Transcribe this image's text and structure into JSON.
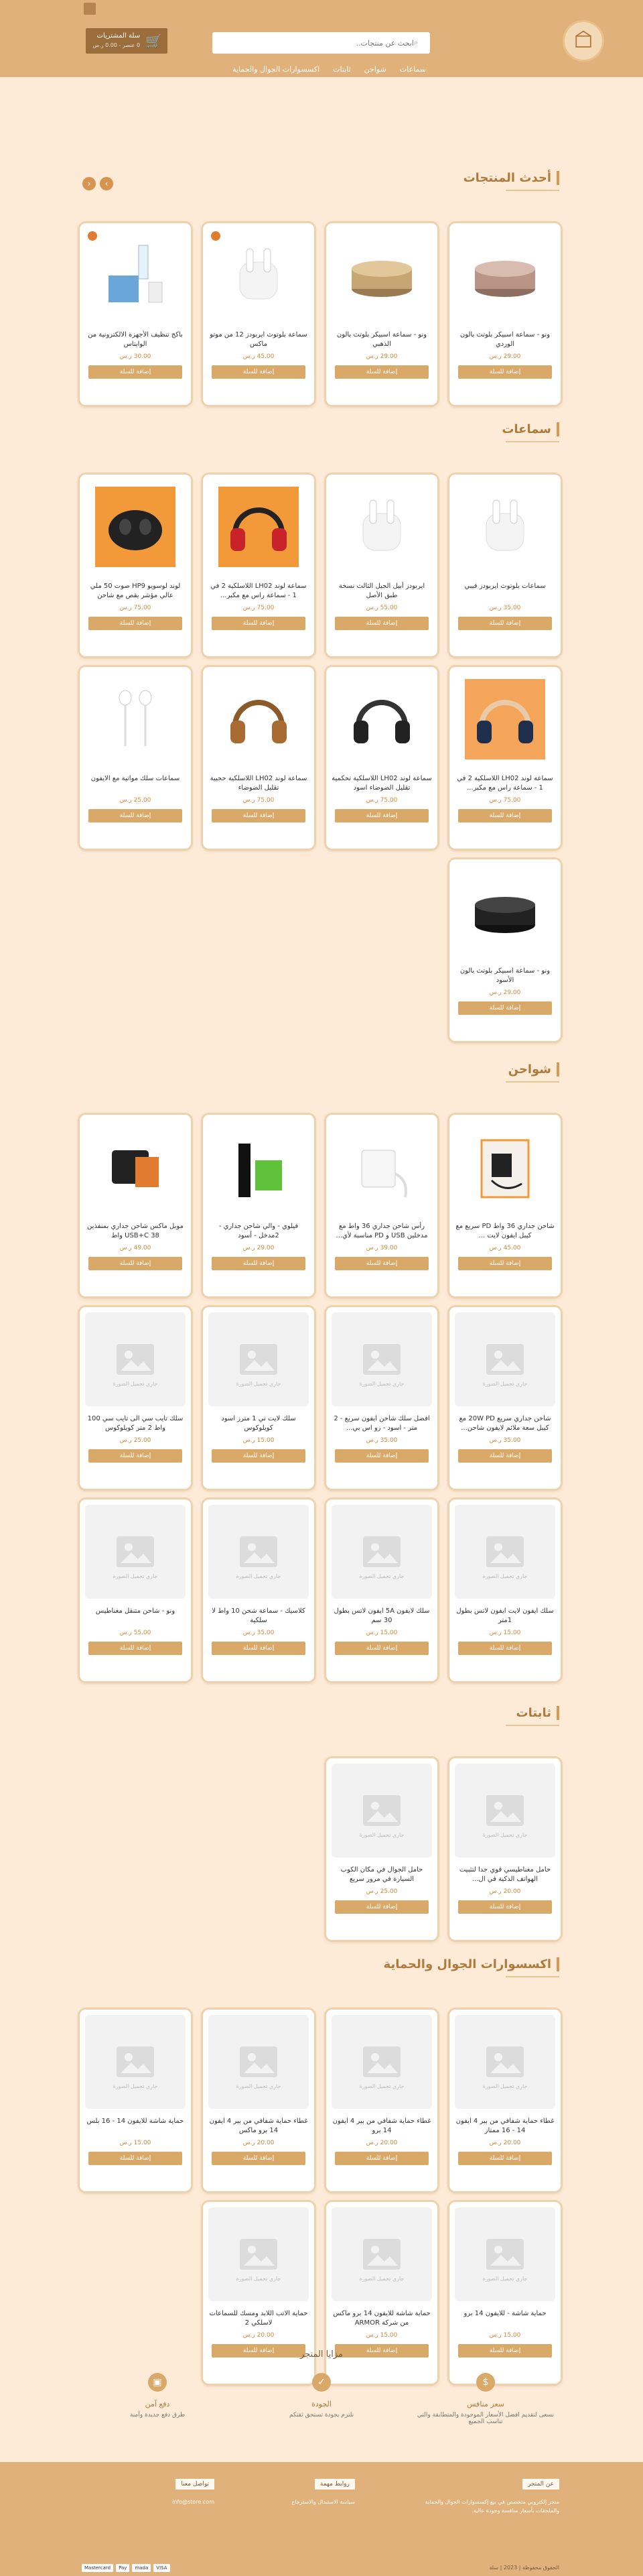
{
  "header": {
    "search_placeholder": "ابحث عن منتجات..",
    "cart_title": "سلة المشتريات",
    "cart_sub": "0 عنصر - 0.00 ر.س",
    "nav": [
      "سماعات",
      "شواحن",
      "ثابتات",
      "اكسسوارات الجوال والحماية"
    ]
  },
  "sections": [
    {
      "title": "أحدث المنتجات",
      "products": [
        {
          "name": "ونو - سماعة اسبيكر بلوتث بالون الوردي",
          "price": "29.00 ر.س",
          "type": "speaker-rose"
        },
        {
          "name": "ونو - سماعة اسبيكر بلوتث بالون الذهبي",
          "price": "29.00 ر.س",
          "type": "speaker-gold"
        },
        {
          "name": "سماعة بلوتوث ايربودز 12 من موتو ماكس",
          "price": "45.00 ر.س",
          "type": "airpods"
        },
        {
          "name": "باكج تنظيف الأجهزة الالكترونية من الوايتاس",
          "price": "30.00 ر.س",
          "type": "cleaning-kit"
        }
      ]
    },
    {
      "title": "سماعات",
      "products": [
        {
          "name": "سماعات بلوتوث ايربودز فيبي",
          "price": "35.00 ر.س",
          "type": "airpods"
        },
        {
          "name": "ايربودز أبيل الجيل الثالث نسخة طبق الأصل",
          "price": "55.00 ر.س",
          "type": "airpods3"
        },
        {
          "name": "سماعة لوند LH02 اللاسلكية 2 في 1 - سماعة راس مع مكبر...",
          "price": "75.00 ر.س",
          "type": "headphone-red"
        },
        {
          "name": "لوند لوسويو HP9 صوت 50 ملي عالي مؤشر يقص مع شاحن",
          "price": "75.00 ر.س",
          "type": "earbud-case"
        },
        {
          "name": "سماعة لوند LH02 اللاسلكية 2 في 1 - سماعة راس مع مكبر...",
          "price": "75.00 ر.س",
          "type": "headphone-navy"
        },
        {
          "name": "سماعة لوند LH02 اللاسلكية تحكمية تقليل الضوضاء اسود",
          "price": "75.00 ر.س",
          "type": "headphone-black"
        },
        {
          "name": "سماعة لوند LH02 اللاسلكية حجبية تقليل الضوضاء",
          "price": "75.00 ر.س",
          "type": "headphone-brown"
        },
        {
          "name": "سماعات سلك مواتية مع الايفون",
          "price": "25.00 ر.س",
          "type": "earphones"
        },
        {
          "name": "ونو - سماعة اسبيكر بلوتث بالون الأسود",
          "price": "29.00 ر.س",
          "type": "speaker-black"
        }
      ]
    },
    {
      "title": "شواحن",
      "products": [
        {
          "name": "شاحن جداري 36 واط PD سريع مع كيبل ايفون لايت ...",
          "price": "45.00 ر.س",
          "type": "charger-pack"
        },
        {
          "name": "رأس شاحن جداري 36 واط مع مدخلين USB و PD مناسبة لأي...",
          "price": "39.00 ر.س",
          "type": "charger-white"
        },
        {
          "name": "فيلوي - والي شاحن جداري - 2مدخل - أسود",
          "price": "29.00 ر.س",
          "type": "charger-green"
        },
        {
          "name": "موبل ماكس شاحن جداري بمنفذين USB+C 38 واط",
          "price": "49.00 ر.س",
          "type": "charger-black"
        },
        {
          "name": "شاحن جداري سريع 20W PD مع كيبل سعة ملائم لايفون شاحن...",
          "price": "35.00 ر.س",
          "type": "placeholder"
        },
        {
          "name": "افضل سلك شاحن ايفون سريع - 2 متر - اسود - زو اس بي...",
          "price": "35.00 ر.س",
          "type": "placeholder"
        },
        {
          "name": "سلك لايت ني 1 مترز اسود كويلوكوس",
          "price": "15.00 ر.س",
          "type": "placeholder"
        },
        {
          "name": "سلك تايب سي الى تايب سي 100 واط 2 متر كويلوكوس",
          "price": "25.00 ر.س",
          "type": "placeholder"
        },
        {
          "name": "سلك ايفون لايت ايفون لاتس بطول 1متر",
          "price": "15.00 ر.س",
          "type": "placeholder"
        },
        {
          "name": "سلك لايفون 5A ايفون لاتس بطول 30 سم",
          "price": "15.00 ر.س",
          "type": "placeholder"
        },
        {
          "name": "كلاسيك - سماعة شحن 10 واط لا سلكية",
          "price": "35.00 ر.س",
          "type": "placeholder"
        },
        {
          "name": "ونو - شاحن متنقل مغناطيس",
          "price": "55.00 ر.س",
          "type": "placeholder"
        }
      ]
    },
    {
      "title": "ثابتات",
      "products": [
        {
          "name": "حامل مغناطيسي قوي جدا لتثبيت الهواتف الذكية في ال...",
          "price": "20.00 ر.س",
          "type": "placeholder"
        },
        {
          "name": "حامل الجوال في مكان الكوب السيارة في مرور سريع",
          "price": "25.00 ر.س",
          "type": "placeholder"
        }
      ]
    },
    {
      "title": "اكسسوارات الجوال والحماية",
      "products": [
        {
          "name": "غطاء حماية شفافي من بير 4 ايفون 14 - 16 ممتاز",
          "price": "20.00 ر.س",
          "type": "placeholder"
        },
        {
          "name": "غطاء حماية شفافي من بير 4 ايفون 14 برو",
          "price": "20.00 ر.س",
          "type": "placeholder"
        },
        {
          "name": "غطاء حماية شفافي من بير 4 ايفون 14 برو ماكس",
          "price": "20.00 ر.س",
          "type": "placeholder"
        },
        {
          "name": "حماية شاشة للايفون 14 - 16 بلس",
          "price": "15.00 ر.س",
          "type": "placeholder"
        },
        {
          "name": "حماية شاشة - للايفون 14 برو",
          "price": "15.00 ر.س",
          "type": "placeholder"
        },
        {
          "name": "حماية شاشة للايفون 14 برو ماكس من شركة ARMOR",
          "price": "15.00 ر.س",
          "type": "placeholder"
        },
        {
          "name": "حماية الاتب اللابد ومسك للسماعات لاسلكي 2",
          "price": "20.00 ر.س",
          "type": "placeholder"
        }
      ]
    }
  ],
  "add_to_cart": "إضافة للسلة",
  "placeholder_text": "جاري تحميل الصورة",
  "features": {
    "title": "مزايا المتجر",
    "items": [
      {
        "title": "سعر منافس",
        "desc": "نسعى لتقديم افضل الأسعار الموجودة والمتطابقة والتي تناسب الجميع"
      },
      {
        "title": "الجودة",
        "desc": "نلتزم بجودة تستحق ثقتكم"
      },
      {
        "title": "دفع آمن",
        "desc": "طرق دفع جديدة وآمنة"
      }
    ]
  },
  "footer": {
    "about_title": "عن المتجر",
    "about_text": "متجر إلكتروني متخصص في بيع إكسسوارات الجوال والحماية والملحقات بأسعار منافسة وجودة عالية.",
    "links_title": "روابط مهمة",
    "links_text": "سياسة الاستبدال والاسترجاع",
    "contact_title": "تواصل معنا",
    "contact_text": "info@store.com",
    "copyright": "الحقوق محفوظة | 2023 | سلة",
    "payments": [
      "VISA",
      "mada",
      "Pay",
      "Mastercard"
    ]
  },
  "colors": {
    "accent": "#d8a968",
    "header": "#e0b17a",
    "background": "#fdebd7",
    "title": "#b07a3d"
  }
}
